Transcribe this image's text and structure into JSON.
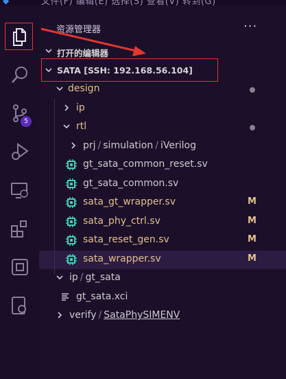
{
  "topbar": {
    "menu_text": "文件(F) 编辑(E) 选择(S) 查看(V) 转到(G)"
  },
  "activity_bar": {
    "items": [
      {
        "name": "explorer-icon"
      },
      {
        "name": "search-icon"
      },
      {
        "name": "source-control-icon",
        "badge": "5"
      },
      {
        "name": "run-debug-icon"
      },
      {
        "name": "remote-explorer-icon"
      },
      {
        "name": "extensions-icon"
      },
      {
        "name": "chip-icon"
      },
      {
        "name": "remote-gear-icon"
      }
    ]
  },
  "sidebar": {
    "title": "资源管理器",
    "more_label": "···",
    "open_editors_label": "打开的编辑器",
    "workspace_label": "SATA [SSH: 192.168.56.104]"
  },
  "tree": [
    {
      "label": "design",
      "type": "folder",
      "expanded": true,
      "color": "#e2c08d",
      "status": "dot"
    },
    {
      "label": "ip",
      "type": "folder",
      "expanded": false,
      "color": "#e2c08d"
    },
    {
      "label": "rtl",
      "type": "folder",
      "expanded": true,
      "color": "#e2c08d",
      "status": "dot"
    },
    {
      "segments": [
        "prj",
        "simulation",
        "iVerilog"
      ],
      "type": "folder",
      "expanded": false,
      "color": "#cccccc"
    },
    {
      "label": "gt_sata_common_reset.sv",
      "type": "file",
      "color": "#cccccc"
    },
    {
      "label": "gt_sata_common.sv",
      "type": "file",
      "color": "#cccccc"
    },
    {
      "label": "sata_gt_wrapper.sv",
      "type": "file",
      "color": "#e2c08d",
      "status": "M"
    },
    {
      "label": "sata_phy_ctrl.sv",
      "type": "file",
      "color": "#e2c08d",
      "status": "M"
    },
    {
      "label": "sata_reset_gen.sv",
      "type": "file",
      "color": "#e2c08d",
      "status": "M"
    },
    {
      "label": "sata_wrapper.sv",
      "type": "file",
      "color": "#e2c08d",
      "status": "M",
      "selected": true
    },
    {
      "segments": [
        "ip",
        "gt_sata"
      ],
      "type": "folder",
      "expanded": true,
      "color": "#cccccc"
    },
    {
      "label": "gt_sata.xci",
      "type": "xci",
      "color": "#cccccc"
    },
    {
      "segments": [
        "verify",
        "SataPhySIMENV"
      ],
      "type": "folder",
      "expanded": false,
      "color": "#cccccc",
      "underline_last": true
    }
  ],
  "colors": {
    "accent_annotation": "#e0372f",
    "modified": "#e2c08d",
    "chip_icon": "#3fd1b3",
    "badge": "#5c2bb8"
  }
}
